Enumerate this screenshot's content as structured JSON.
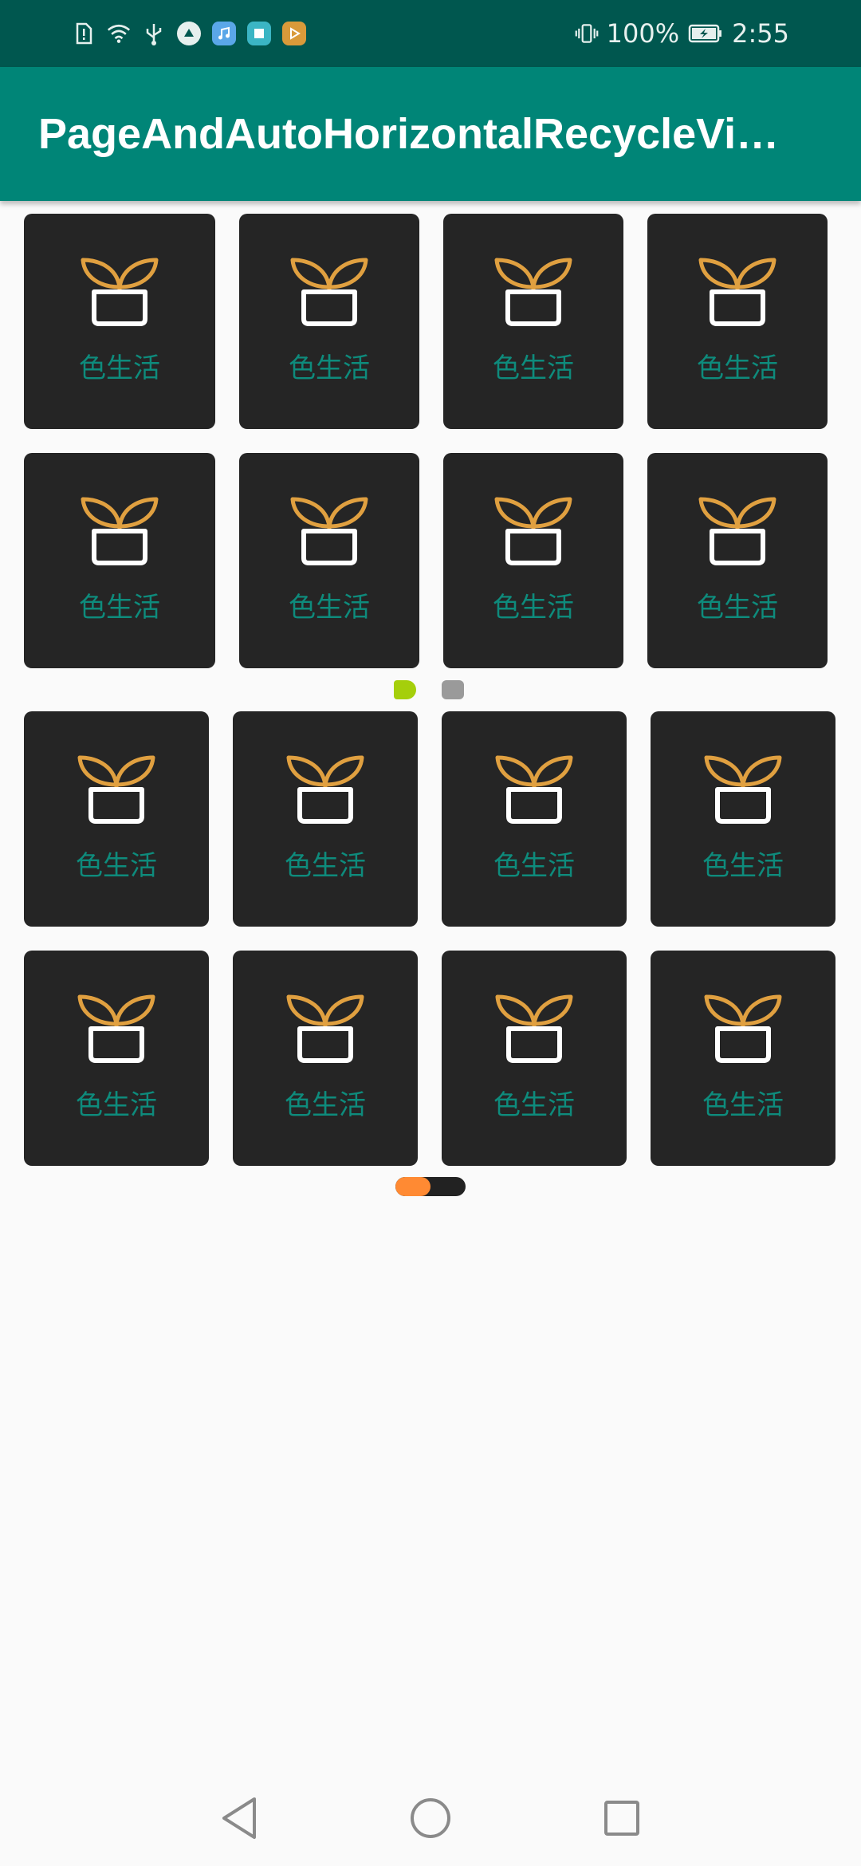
{
  "status_bar": {
    "battery": "100%",
    "time": "2:55",
    "icons": [
      "sim-alert-icon",
      "wifi-icon",
      "usb-icon",
      "vpn-icon",
      "music-app-icon",
      "book-app-icon",
      "video-app-icon",
      "vibrate-icon",
      "battery-charging-icon"
    ]
  },
  "app_bar": {
    "title": "PageAndAutoHorizontalRecycleVi…"
  },
  "grid_page_1": {
    "items": [
      {
        "label": "色生活",
        "icon": "plant-icon"
      },
      {
        "label": "色生活",
        "icon": "plant-icon"
      },
      {
        "label": "色生活",
        "icon": "plant-icon"
      },
      {
        "label": "色生活",
        "icon": "plant-icon"
      },
      {
        "label": "色生活",
        "icon": "plant-icon"
      },
      {
        "label": "色生活",
        "icon": "plant-icon"
      },
      {
        "label": "色生活",
        "icon": "plant-icon"
      },
      {
        "label": "色生活",
        "icon": "plant-icon"
      }
    ],
    "page_indicator": {
      "pages": 2,
      "current": 1,
      "active_color": "#a5cf0b",
      "inactive_color": "#9a9a9a"
    }
  },
  "grid_page_2": {
    "items": [
      {
        "label": "色生活",
        "icon": "plant-icon"
      },
      {
        "label": "色生活",
        "icon": "plant-icon"
      },
      {
        "label": "色生活",
        "icon": "plant-icon"
      },
      {
        "label": "色生活",
        "icon": "plant-icon"
      },
      {
        "label": "色生活",
        "icon": "plant-icon"
      },
      {
        "label": "色生活",
        "icon": "plant-icon"
      },
      {
        "label": "色生活",
        "icon": "plant-icon"
      },
      {
        "label": "色生活",
        "icon": "plant-icon"
      }
    ],
    "scroll_indicator": {
      "progress": 0.5,
      "thumb_color": "#ff8a33",
      "track_color": "#222222"
    }
  },
  "nav_bar": {
    "buttons": [
      "back-icon",
      "home-icon",
      "recents-icon"
    ]
  },
  "colors": {
    "status_bar": "#00574f",
    "app_bar": "#008577",
    "tile_bg": "#252525",
    "label": "#0e8b7c",
    "plant_leaf": "#e0a040",
    "pot": "#ffffff"
  }
}
